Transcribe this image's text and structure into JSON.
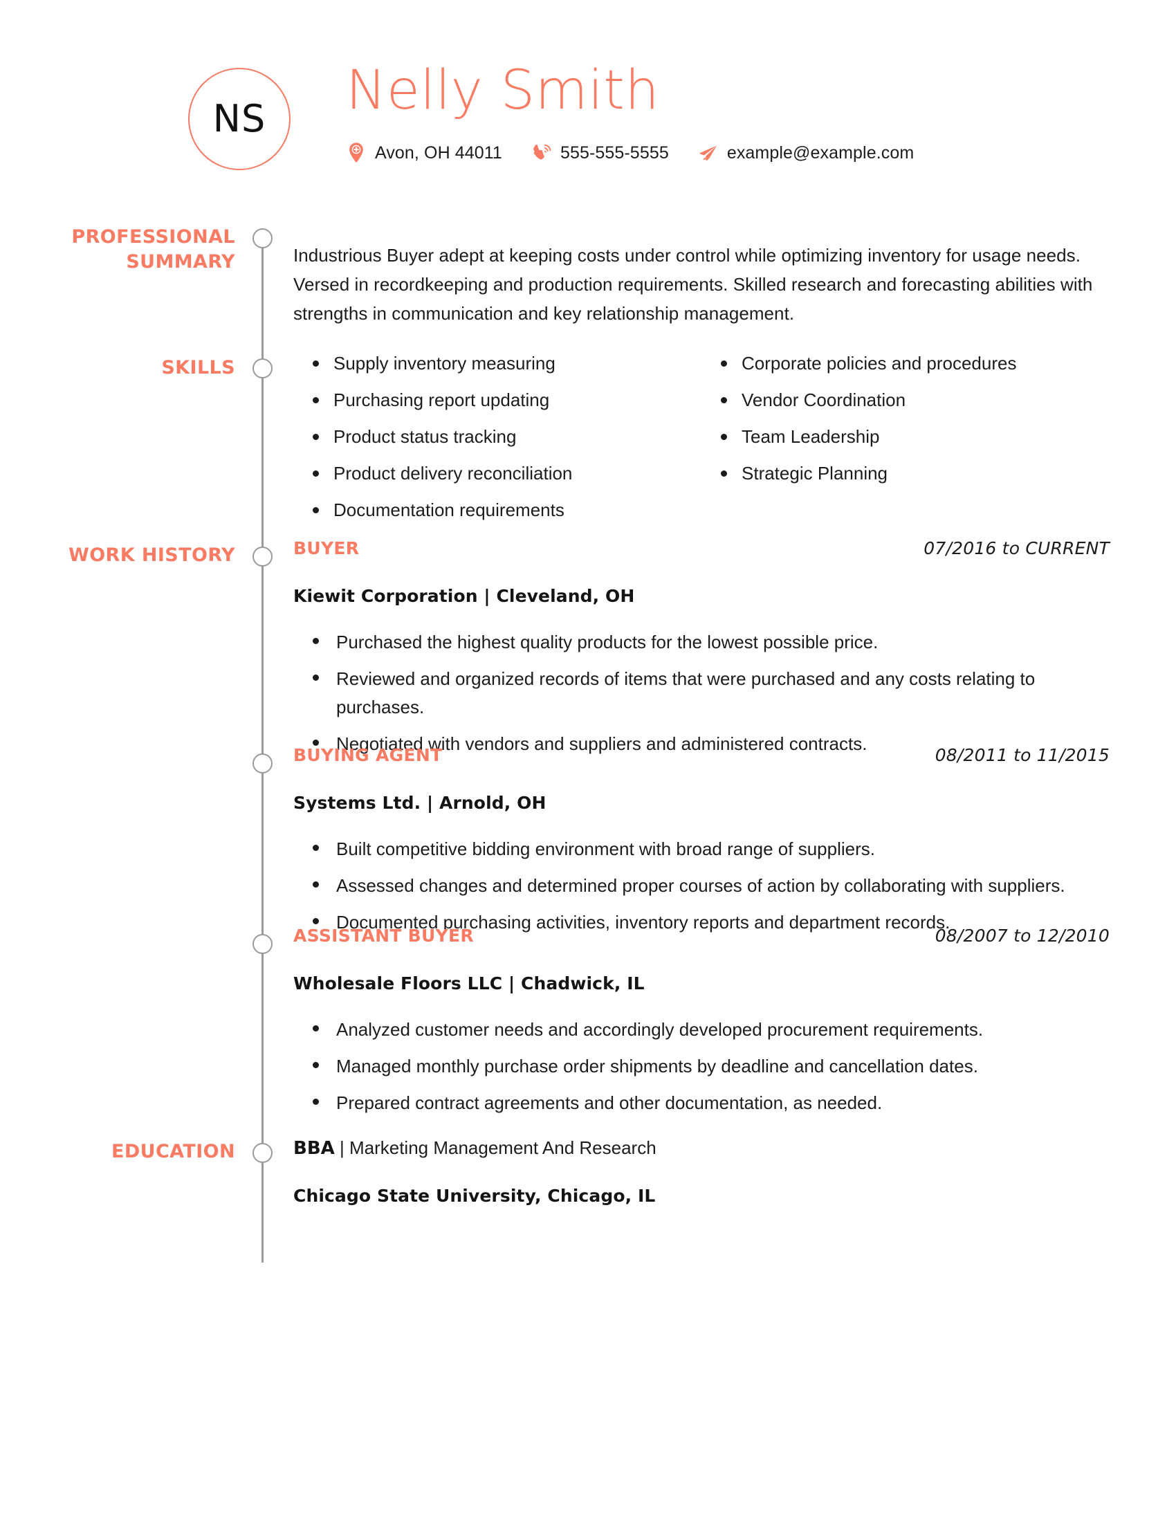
{
  "header": {
    "monogram": "NS",
    "name": "Nelly Smith",
    "contact": {
      "location": "Avon, OH 44011",
      "phone": "555-555-5555",
      "email": "example@example.com"
    }
  },
  "accent_color": "#f97b63",
  "timeline_color": "#9a9a9a",
  "sections": {
    "summary": {
      "label_line1": "PROFESSIONAL",
      "label_line2": "SUMMARY",
      "text": "Industrious Buyer adept at keeping costs under control while optimizing inventory for usage needs. Versed in recordkeeping and production requirements. Skilled research and forecasting abilities with strengths in communication and key relationship management."
    },
    "skills": {
      "label": "SKILLS",
      "column_left": [
        "Supply inventory measuring",
        "Purchasing report updating",
        "Product status tracking",
        "Product delivery reconciliation",
        "Documentation requirements"
      ],
      "column_right": [
        "Corporate policies and procedures",
        "Vendor Coordination",
        "Team Leadership",
        "Strategic Planning"
      ]
    },
    "work_history": {
      "label": "WORK HISTORY",
      "jobs": [
        {
          "title": "BUYER",
          "dates": "07/2016 to CURRENT",
          "company": "Kiewit Corporation | Cleveland, OH",
          "bullets": [
            "Purchased the highest quality products for the lowest possible price.",
            "Reviewed and organized records of items that were purchased and any costs relating to purchases.",
            "Negotiated with vendors and suppliers and administered contracts."
          ]
        },
        {
          "title": "BUYING AGENT",
          "dates": "08/2011 to 11/2015",
          "company": "Systems Ltd. | Arnold, OH",
          "bullets": [
            "Built competitive bidding environment with broad range of suppliers.",
            "Assessed changes and determined proper courses of action by collaborating with suppliers.",
            "Documented purchasing activities, inventory reports and department records."
          ]
        },
        {
          "title": "ASSISTANT BUYER",
          "dates": "08/2007 to 12/2010",
          "company": "Wholesale Floors LLC | Chadwick, IL",
          "bullets": [
            "Analyzed customer needs and accordingly developed procurement requirements.",
            "Managed monthly purchase order shipments by deadline and cancellation dates.",
            "Prepared contract agreements and other documentation, as needed."
          ]
        }
      ]
    },
    "education": {
      "label": "EDUCATION",
      "degree": "BBA",
      "separator": " | ",
      "field": "Marketing Management And Research",
      "school": "Chicago State University, Chicago, IL"
    }
  }
}
